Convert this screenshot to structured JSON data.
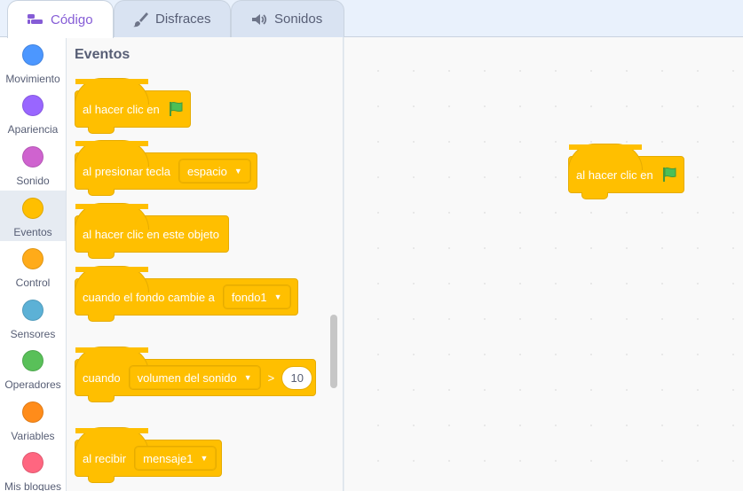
{
  "tabs": [
    {
      "label": "Código",
      "icon": "code-icon"
    },
    {
      "label": "Disfraces",
      "icon": "brush-icon"
    },
    {
      "label": "Sonidos",
      "icon": "speaker-icon"
    }
  ],
  "categories": [
    {
      "label": "Movimiento",
      "color": "#4c97ff"
    },
    {
      "label": "Apariencia",
      "color": "#9966ff"
    },
    {
      "label": "Sonido",
      "color": "#cf63cf"
    },
    {
      "label": "Eventos",
      "color": "#ffbf00"
    },
    {
      "label": "Control",
      "color": "#ffab19"
    },
    {
      "label": "Sensores",
      "color": "#5cb1d6"
    },
    {
      "label": "Operadores",
      "color": "#59c059"
    },
    {
      "label": "Variables",
      "color": "#ff8c1a"
    },
    {
      "label": "Mis bloques",
      "color": "#ff6680"
    }
  ],
  "palette": {
    "title": "Eventos",
    "blocks": {
      "flag_clicked": {
        "text": "al hacer clic en",
        "icon": "green-flag-icon"
      },
      "key_pressed": {
        "text": "al presionar tecla",
        "key": "espacio"
      },
      "sprite_clicked": {
        "text": "al hacer clic en este objeto"
      },
      "backdrop_switch": {
        "text": "cuando el fondo cambie a",
        "backdrop": "fondo1"
      },
      "greater_than": {
        "text": "cuando",
        "sensor": "volumen del sonido",
        "operator": ">",
        "value": "10"
      },
      "broadcast_received": {
        "text": "al recibir",
        "message": "mensaje1"
      }
    }
  },
  "workspace": {
    "block": {
      "text": "al hacer clic en",
      "icon": "green-flag-icon"
    }
  },
  "colors": {
    "events": "#ffbf00",
    "accent": "#855cd6",
    "flag": "#4cbf56"
  }
}
